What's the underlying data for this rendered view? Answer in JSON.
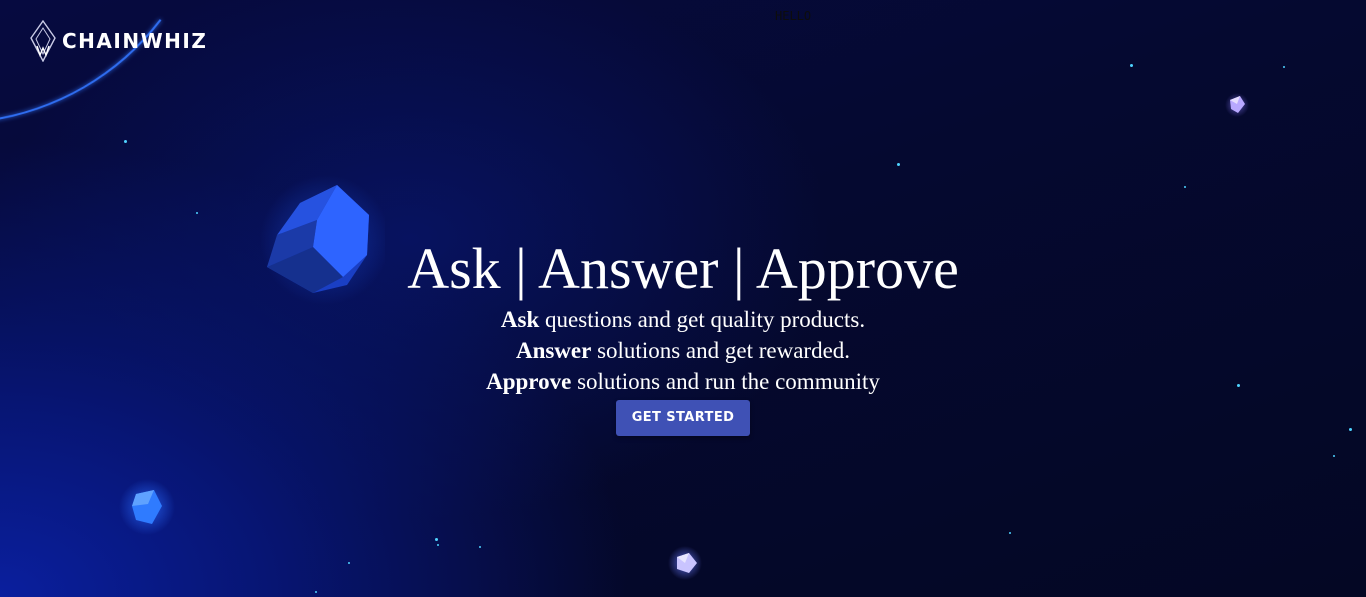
{
  "brand": {
    "name": "CHAINWHIZ",
    "icon": "chainwhiz-logo-icon"
  },
  "debug_text": "HELLO",
  "hero": {
    "title": "Ask | Answer | Approve",
    "lines": [
      {
        "bold": "Ask",
        "rest": " questions and get quality products."
      },
      {
        "bold": "Answer",
        "rest": " solutions and get rewarded."
      },
      {
        "bold": "Approve",
        "rest": " solutions and run the community"
      }
    ],
    "cta_label": "GET STARTED"
  },
  "colors": {
    "background": "#050930",
    "accent_blue": "#2f6df0",
    "button": "#3f51b5",
    "text": "#ffffff"
  }
}
